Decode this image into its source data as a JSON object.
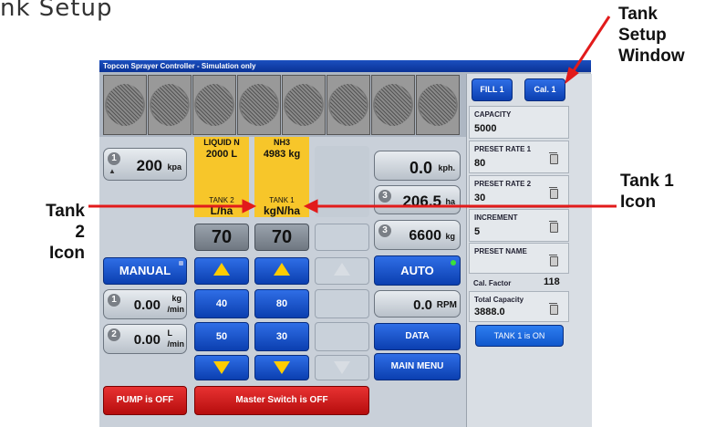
{
  "page": {
    "heading": "nk Setup",
    "callout_tank_setup": [
      "Tank",
      "Setup",
      "Window"
    ],
    "callout_tank1": [
      "Tank 1",
      "Icon"
    ],
    "callout_tank2": [
      "Tank 2",
      "Icon"
    ],
    "arrow_color": "#e21b1b"
  },
  "window": {
    "title": "Topcon Sprayer Controller - Simulation only"
  },
  "readouts": {
    "pressure": {
      "badge": "1",
      "value": "200",
      "unit": "kpa"
    },
    "speed": {
      "value": "0.0",
      "unit": "kph."
    },
    "area": {
      "badge": "3",
      "value": "206.5",
      "unit": "ha"
    },
    "weight": {
      "badge": "3",
      "value": "6600",
      "unit": "kg"
    },
    "rpm": {
      "value": "0.0",
      "unit": "RPM"
    },
    "flow1": {
      "badge": "1",
      "value": "0.00",
      "unit_top": "kg",
      "unit_bottom": "/min"
    },
    "flow2": {
      "badge": "2",
      "value": "0.00",
      "unit_top": "L",
      "unit_bottom": "/min"
    }
  },
  "tanks": [
    {
      "product": "LIQUID N",
      "amount": "2000 L",
      "name": "TANK 2",
      "rate_unit": "L/ha",
      "rate": "70",
      "preset_1": "40",
      "preset_2": "50"
    },
    {
      "product": "NH3",
      "amount": "4983 kg",
      "name": "TANK 1",
      "rate_unit": "kgN/ha",
      "rate": "70",
      "preset_1": "80",
      "preset_2": "30"
    }
  ],
  "buttons": {
    "manual": "MANUAL",
    "auto": "AUTO",
    "data": "DATA",
    "main_menu": "MAIN MENU",
    "pump": "PUMP is OFF",
    "master": "Master Switch is OFF",
    "fill": "FILL 1",
    "cal": "Cal. 1",
    "tank_status": "TANK 1 is ON"
  },
  "setup": {
    "capacity_label": "CAPACITY",
    "capacity_value": "5000",
    "preset1_label": "PRESET RATE 1",
    "preset1_value": "80",
    "preset2_label": "PRESET RATE 2",
    "preset2_value": "30",
    "increment_label": "INCREMENT",
    "increment_value": "5",
    "preset_name_label": "PRESET NAME",
    "cal_factor_label": "Cal. Factor",
    "cal_factor_value": "118",
    "total_capacity_label": "Total Capacity",
    "total_capacity_value": "3888.0"
  }
}
